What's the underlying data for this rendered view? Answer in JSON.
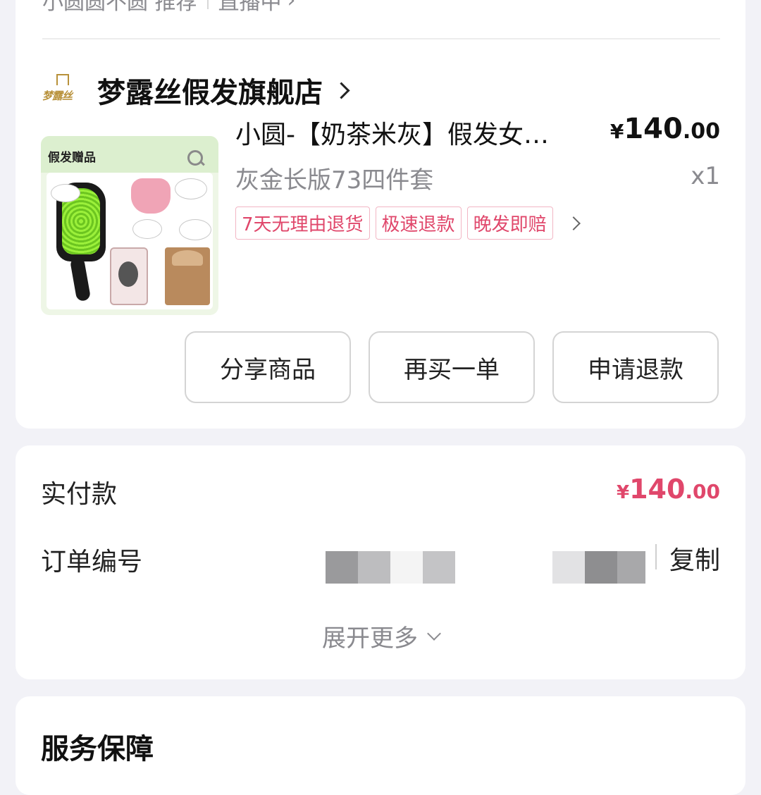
{
  "top_row": {
    "text": "小圆圆不圆 推荐",
    "live_text": "直播中"
  },
  "store": {
    "logo_text": "梦露丝",
    "name": "梦露丝假发旗舰店"
  },
  "product": {
    "image_banner_text": "假发赠品",
    "title": "小圆-【奶茶米灰】假发女…",
    "spec": "灰金长版73四件套",
    "price": {
      "symbol": "¥",
      "integer": "140",
      "decimal": ".00"
    },
    "quantity": "x1",
    "tags": [
      "7天无理由退货",
      "极速退款",
      "晚发即赔"
    ]
  },
  "actions": {
    "share": "分享商品",
    "rebuy": "再买一单",
    "refund": "申请退款"
  },
  "payment": {
    "paid_label": "实付款",
    "paid_price": {
      "symbol": "¥",
      "integer": "140",
      "decimal": ".00"
    },
    "order_label": "订单编号",
    "copy_label": "复制",
    "expand_label": "展开更多"
  },
  "service": {
    "title": "服务保障"
  },
  "colors": {
    "accent_pink": "#e0476b",
    "tag_border": "#f2b6c4",
    "background": "#f2f2f7",
    "secondary_text": "#8a8a8f"
  },
  "icons": [
    "chevron-right-icon",
    "chevron-down-icon",
    "store-logo",
    "search-icon"
  ]
}
